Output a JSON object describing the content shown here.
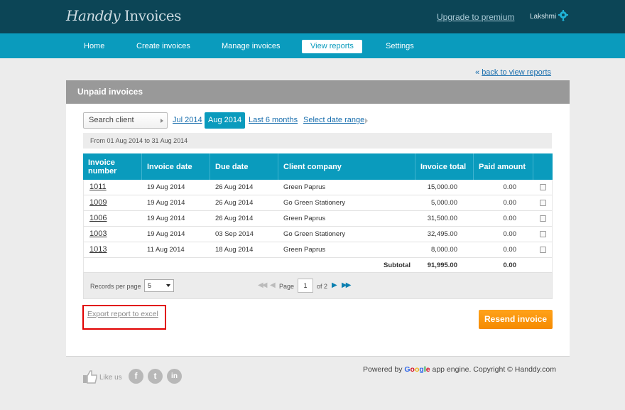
{
  "app": {
    "logo_brand": "Handdy",
    "logo_rest": "Invoices"
  },
  "header": {
    "upgrade": "Upgrade to premium",
    "user": "Lakshmi"
  },
  "nav": [
    "Home",
    "Create invoices",
    "Manage invoices",
    "View reports",
    "Settings"
  ],
  "nav_active": "View reports",
  "back_link": "back to view reports",
  "back_glyph": "«",
  "page_title": "Unpaid invoices",
  "filters": {
    "search_placeholder": "Search client",
    "periods": [
      "Jul 2014",
      "Aug 2014",
      "Last 6 months",
      "Select date range"
    ],
    "active_period": "Aug 2014",
    "range_text": "From 01 Aug 2014 to 31 Aug 2014"
  },
  "table": {
    "headers": [
      "Invoice number",
      "Invoice date",
      "Due date",
      "Client company",
      "Invoice total",
      "Paid amount",
      ""
    ],
    "rows": [
      [
        "1011",
        "19 Aug 2014",
        "26 Aug 2014",
        "Green Paprus",
        "15,000.00",
        "0.00"
      ],
      [
        "1009",
        "19 Aug 2014",
        "26 Aug 2014",
        "Go Green Stationery",
        "5,000.00",
        "0.00"
      ],
      [
        "1006",
        "19 Aug 2014",
        "26 Aug 2014",
        "Green Paprus",
        "31,500.00",
        "0.00"
      ],
      [
        "1003",
        "19 Aug 2014",
        "03 Sep 2014",
        "Go Green Stationery",
        "32,495.00",
        "0.00"
      ],
      [
        "1013",
        "11 Aug 2014",
        "18 Aug 2014",
        "Green Paprus",
        "8,000.00",
        "0.00"
      ]
    ],
    "subtotal_label": "Subtotal",
    "subtotal_total": "91,995.00",
    "subtotal_paid": "0.00"
  },
  "pager": {
    "records_label": "Records per page",
    "records_value": "5",
    "page_label": "Page",
    "page_value": "1",
    "of_label": "of 2"
  },
  "actions": {
    "export": "Export report to excel",
    "resend": "Resend invoice"
  },
  "footer": {
    "like_us": "Like us",
    "powered_prefix": "Powered by",
    "google_g": "G",
    "google_o1": "o",
    "google_o2": "o",
    "google_g2": "g",
    "google_l": "l",
    "google_e": "e",
    "powered_suffix": "app engine. Copyright © Handdy.com",
    "social": [
      "f",
      "t",
      "in"
    ]
  },
  "colors": {
    "topbar": "#0c4556",
    "nav": "#0a9bbd",
    "accent": "#f58a00",
    "highlight_box": "#e10000"
  }
}
